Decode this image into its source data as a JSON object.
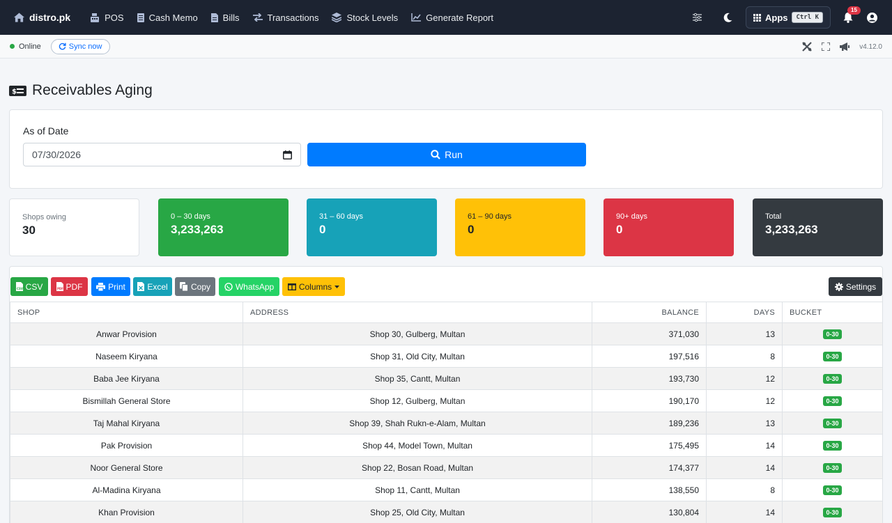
{
  "navbar": {
    "brand": "distro.pk",
    "links": [
      {
        "label": "POS",
        "icon": "cash-register-icon"
      },
      {
        "label": "Cash Memo",
        "icon": "document-icon"
      },
      {
        "label": "Bills",
        "icon": "file-icon"
      },
      {
        "label": "Transactions",
        "icon": "swap-arrows-icon"
      },
      {
        "label": "Stock Levels",
        "icon": "layers-icon"
      },
      {
        "label": "Generate Report",
        "icon": "line-chart-icon"
      }
    ],
    "apps_label": "Apps",
    "apps_shortcut": "Ctrl K",
    "notification_count": "15"
  },
  "statusbar": {
    "status": "Online",
    "sync_label": "Sync now",
    "version": "v4.12.0"
  },
  "page": {
    "title": "Receivables Aging"
  },
  "form": {
    "date_label": "As of Date",
    "date_value": "07/30/2026",
    "run_label": "Run"
  },
  "summary": [
    {
      "label": "Shops owing",
      "value": "30",
      "color": "#ffffff"
    },
    {
      "label": "0 – 30 days",
      "value": "3,233,263",
      "color": "#28a745"
    },
    {
      "label": "31 – 60 days",
      "value": "0",
      "color": "#17a2b8"
    },
    {
      "label": "61 – 90 days",
      "value": "0",
      "color": "#ffc107"
    },
    {
      "label": "90+ days",
      "value": "0",
      "color": "#dc3545"
    },
    {
      "label": "Total",
      "value": "3,233,263",
      "color": "#343a40"
    }
  ],
  "toolbar": {
    "csv": "CSV",
    "pdf": "PDF",
    "print": "Print",
    "excel": "Excel",
    "copy": "Copy",
    "whatsapp": "WhatsApp",
    "columns": "Columns",
    "settings": "Settings"
  },
  "table": {
    "headers": [
      "SHOP",
      "ADDRESS",
      "BALANCE",
      "DAYS",
      "BUCKET"
    ],
    "rows": [
      {
        "shop": "Anwar Provision",
        "address": "Shop 30, Gulberg, Multan",
        "balance": "371,030",
        "days": "13",
        "bucket": "0-30"
      },
      {
        "shop": "Naseem Kiryana",
        "address": "Shop 31, Old City, Multan",
        "balance": "197,516",
        "days": "8",
        "bucket": "0-30"
      },
      {
        "shop": "Baba Jee Kiryana",
        "address": "Shop 35, Cantt, Multan",
        "balance": "193,730",
        "days": "12",
        "bucket": "0-30"
      },
      {
        "shop": "Bismillah General Store",
        "address": "Shop 12, Gulberg, Multan",
        "balance": "190,170",
        "days": "12",
        "bucket": "0-30"
      },
      {
        "shop": "Taj Mahal Kiryana",
        "address": "Shop 39, Shah Rukn-e-Alam, Multan",
        "balance": "189,236",
        "days": "13",
        "bucket": "0-30"
      },
      {
        "shop": "Pak Provision",
        "address": "Shop 44, Model Town, Multan",
        "balance": "175,495",
        "days": "14",
        "bucket": "0-30"
      },
      {
        "shop": "Noor General Store",
        "address": "Shop 22, Bosan Road, Multan",
        "balance": "174,377",
        "days": "14",
        "bucket": "0-30"
      },
      {
        "shop": "Al-Madina Kiryana",
        "address": "Shop 11, Cantt, Multan",
        "balance": "138,550",
        "days": "8",
        "bucket": "0-30"
      },
      {
        "shop": "Khan Provision",
        "address": "Shop 25, Old City, Multan",
        "balance": "130,804",
        "days": "14",
        "bucket": "0-30"
      }
    ]
  }
}
